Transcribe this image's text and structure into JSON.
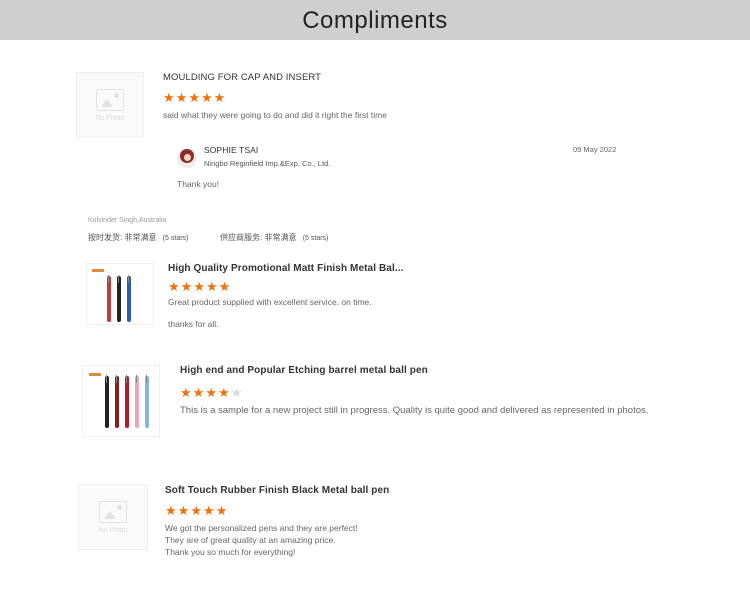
{
  "page": {
    "title": "Compliments"
  },
  "reviews": [
    {
      "product": "MOULDING FOR CAP AND INSERT",
      "rating": 5,
      "no_photo": "No Photo",
      "text": "said what they were going to do and did it right the first time",
      "reply": {
        "name": "SOPHIE TSAI",
        "company": "Ningbo Reginfield Imp.&Exp. Co., Ltd.",
        "date": "09 May 2022",
        "text": "Thank you!"
      }
    },
    {
      "reviewer": "Kulvinder Singh,Australia",
      "delivery_label": "按时发货:",
      "delivery_value": "非常满意",
      "delivery_stars": "(5 stars)",
      "service_label": "供应商服务:",
      "service_value": "非常满意",
      "service_stars": "(5 stars)"
    },
    {
      "product": "High Quality Promotional Matt Finish Metal Bal...",
      "rating": 5,
      "text": "Great product supplied with excellent service. on time.",
      "text2": "thanks for all."
    },
    {
      "product": "High end and Popular Etching barrel metal ball pen",
      "rating": 4,
      "text": "This is a sample for a new project still in progress. Quality is quite good and delivered as represented in photos."
    },
    {
      "product": "Soft Touch Rubber Finish Black Metal ball pen",
      "rating": 5,
      "no_photo": "No Photo",
      "lines": [
        "We got the personalized pens and they are perfect!",
        "They are of great quality at an amazing price.",
        "Thank you so much for everything!"
      ]
    }
  ],
  "colors": {
    "star": "#f0700a",
    "star_off": "#d9d9d9",
    "header_bg": "#cfcfcf"
  },
  "icons": {
    "star": "star-icon",
    "no_photo": "image-placeholder-icon"
  }
}
